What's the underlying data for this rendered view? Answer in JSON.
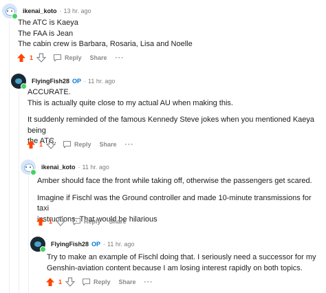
{
  "colors": {
    "upvote": "#ff4500",
    "op": "#0079d3",
    "meta": "#7c7c7c",
    "action": "#878a8c"
  },
  "comments": [
    {
      "username": "ikenai_koto",
      "op": "",
      "separator": "·",
      "time": "13 hr. ago",
      "lines": [
        "The ATC is Kaeya",
        "The FAA is Jean",
        "The cabin crew is Barbara, Rosaria, Lisa and Noelle"
      ],
      "score": "1",
      "upvoted": true,
      "reply": "Reply",
      "share": "Share",
      "more": "···"
    },
    {
      "username": "FlyingFish28",
      "op": "OP",
      "separator": "·",
      "time": "11 hr. ago",
      "lines": [
        "ACCURATE.",
        "This is actually quite close to my actual AU when making this."
      ],
      "lines2": [
        "It suddenly reminded of the famous Kennedy Steve jokes when you mentioned Kaeya being",
        "the ATC."
      ],
      "score": "1",
      "upvoted": true,
      "reply": "Reply",
      "share": "Share",
      "more": "···"
    },
    {
      "username": "ikenai_koto",
      "op": "",
      "separator": "·",
      "time": "11 hr. ago",
      "lines": [
        "Amber should face the front while taking off, otherwise the passengers get scared."
      ],
      "lines2": [
        "Imagine if Fischl was the Ground controller and made 10-minute transmissions for taxi",
        "instructions. That would be hilarious"
      ],
      "score": "1",
      "upvoted": true,
      "reply": "Reply",
      "share": "Share",
      "more": "···"
    },
    {
      "username": "FlyingFish28",
      "op": "OP",
      "separator": "·",
      "time": "11 hr. ago",
      "lines": [
        "Try to make an example of Fischl doing that. I seriously need a successor for my",
        "Genshin-aviation content because I am losing interest rapidly on both topics."
      ],
      "score": "1",
      "upvoted": true,
      "reply": "Reply",
      "share": "Share",
      "more": "···"
    }
  ]
}
